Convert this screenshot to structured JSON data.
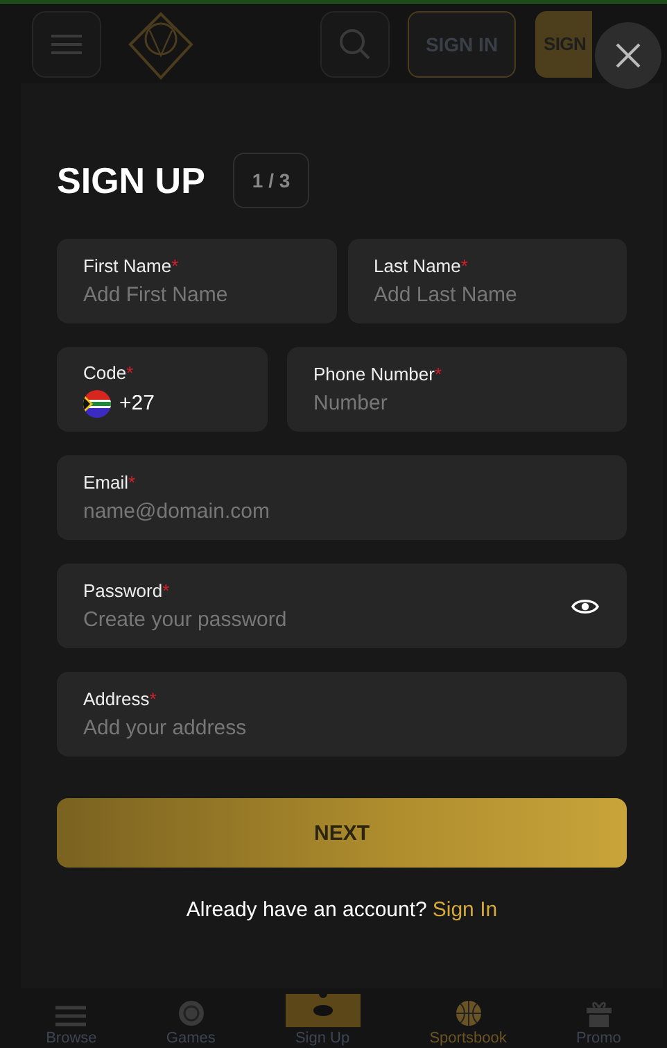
{
  "header": {
    "sign_in": "SIGN IN",
    "sign_up": "SIGN"
  },
  "modal": {
    "title": "SIGN UP",
    "step": "1 / 3",
    "rows": [
      {
        "fields": [
          {
            "kind": "text",
            "label": "First Name",
            "required_mark": "*",
            "placeholder": "Add First Name"
          },
          {
            "kind": "text",
            "label": "Last Name",
            "required_mark": "*",
            "placeholder": "Add Last Name"
          }
        ]
      },
      {
        "fields": [
          {
            "kind": "code",
            "label": "Code",
            "required_mark": "*",
            "value": "+27"
          },
          {
            "kind": "text",
            "label": "Phone Number",
            "required_mark": "*",
            "placeholder": "Number"
          }
        ]
      },
      {
        "fields": [
          {
            "kind": "text",
            "label": "Email",
            "required_mark": "*",
            "placeholder": "name@domain.com"
          }
        ]
      },
      {
        "fields": [
          {
            "kind": "password",
            "label": "Password",
            "required_mark": "*",
            "placeholder": "Create your password"
          }
        ]
      },
      {
        "fields": [
          {
            "kind": "text",
            "label": "Address",
            "required_mark": "*",
            "placeholder": "Add your address"
          }
        ]
      }
    ],
    "next": "NEXT",
    "account_prompt": "Already have an account?",
    "sign_in_link": "Sign In"
  },
  "bottom_nav": [
    {
      "kind": "menu",
      "label": "Browse",
      "selected": false
    },
    {
      "kind": "chip",
      "label": "Games",
      "selected": false
    },
    {
      "kind": "signup",
      "label": "Sign Up",
      "selected": false
    },
    {
      "kind": "ball",
      "label": "Sportsbook",
      "selected": true
    },
    {
      "kind": "gift",
      "label": "Promo",
      "selected": false
    }
  ]
}
